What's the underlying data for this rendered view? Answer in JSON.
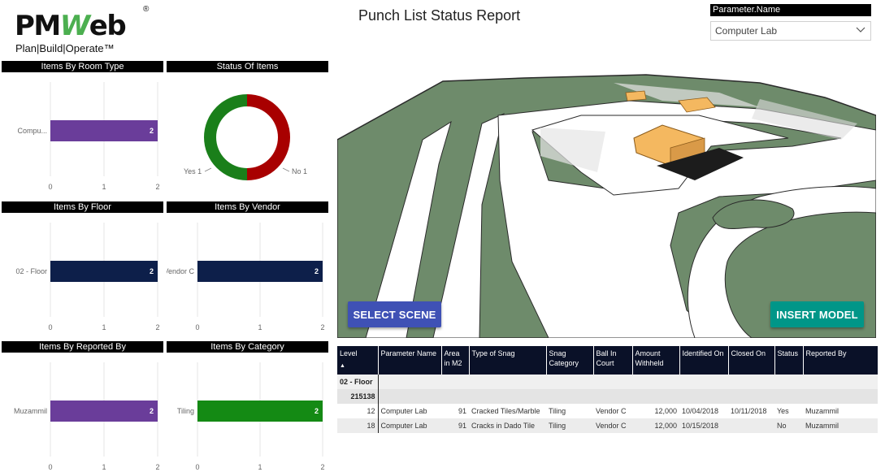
{
  "logo": {
    "main_pm": "PM",
    "main_w": "W",
    "main_eb": "eb",
    "reg": "®",
    "tagline": "Plan|Build|Operate™"
  },
  "report_title": "Punch List Status Report",
  "parameter": {
    "header": "Parameter.Name",
    "selected": "Computer Lab",
    "icon": "chevron-down-icon"
  },
  "charts": {
    "room_type": {
      "title": "Items By Room Type",
      "category": "Compu...",
      "value": "2",
      "color": "#6a3d9a",
      "ticks": [
        "0",
        "1",
        "2"
      ]
    },
    "status": {
      "title": "Status Of Items",
      "yes_label": "Yes 1",
      "no_label": "No 1",
      "yes_color": "#1a7f1a",
      "no_color": "#a80000"
    },
    "floor": {
      "title": "Items By Floor",
      "category": "02 - Floor",
      "value": "2",
      "color": "#0d1f4a",
      "ticks": [
        "0",
        "1",
        "2"
      ]
    },
    "vendor": {
      "title": "Items By Vendor",
      "category": "Vendor C",
      "value": "2",
      "color": "#0d1f4a",
      "ticks": [
        "0",
        "1",
        "2"
      ]
    },
    "reported_by": {
      "title": "Items By Reported By",
      "category": "Muzammil",
      "value": "2",
      "color": "#6a3d9a",
      "ticks": [
        "0",
        "1",
        "2"
      ]
    },
    "category": {
      "title": "Items By Category",
      "category": "Tiling",
      "value": "2",
      "color": "#148a14",
      "ticks": [
        "0",
        "1",
        "2"
      ]
    }
  },
  "chart_data": [
    {
      "type": "bar",
      "title": "Items By Room Type",
      "categories": [
        "Compu..."
      ],
      "values": [
        2
      ],
      "xlim": [
        0,
        2
      ]
    },
    {
      "type": "pie",
      "title": "Status Of Items",
      "categories": [
        "Yes",
        "No"
      ],
      "values": [
        1,
        1
      ]
    },
    {
      "type": "bar",
      "title": "Items By Floor",
      "categories": [
        "02 - Floor"
      ],
      "values": [
        2
      ],
      "xlim": [
        0,
        2
      ]
    },
    {
      "type": "bar",
      "title": "Items By Vendor",
      "categories": [
        "Vendor C"
      ],
      "values": [
        2
      ],
      "xlim": [
        0,
        2
      ]
    },
    {
      "type": "bar",
      "title": "Items By Reported By",
      "categories": [
        "Muzammil"
      ],
      "values": [
        2
      ],
      "xlim": [
        0,
        2
      ]
    },
    {
      "type": "bar",
      "title": "Items By Category",
      "categories": [
        "Tiling"
      ],
      "values": [
        2
      ],
      "xlim": [
        0,
        2
      ]
    }
  ],
  "scene": {
    "select_label": "SELECT SCENE",
    "insert_label": "INSERT MODEL"
  },
  "table": {
    "headers": [
      "Level",
      "Parameter Name",
      "Area in M2",
      "Type of Snag",
      "Snag Category",
      "Ball In Court",
      "Amount Withheld",
      "Identified On",
      "Closed On",
      "Status",
      "Reported By"
    ],
    "group_level": "02 - Floor",
    "group_id": "215138",
    "rows": [
      [
        "12",
        "Computer Lab",
        "91",
        "Cracked Tiles/Marble",
        "Tiling",
        "Vendor C",
        "12,000",
        "10/04/2018",
        "10/11/2018",
        "Yes",
        "Muzammil"
      ],
      [
        "18",
        "Computer Lab",
        "91",
        "Cracks in Dado Tile",
        "Tiling",
        "Vendor C",
        "12,000",
        "10/15/2018",
        "",
        "No",
        "Muzammil"
      ]
    ]
  }
}
